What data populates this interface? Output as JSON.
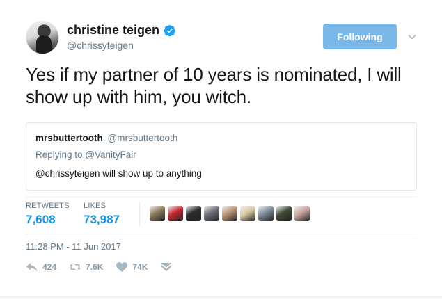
{
  "author": {
    "display_name": "christine teigen",
    "handle": "@chrissyteigen"
  },
  "follow_button": {
    "label": "Following"
  },
  "tweet": {
    "text": "Yes if my partner of 10 years is nominated, I will show up with him, you witch."
  },
  "quoted_tweet": {
    "author_name": "mrsbuttertooth",
    "author_handle": "@mrsbuttertooth",
    "reply_prefix": "Replying to",
    "reply_to": "@VanityFair",
    "text": "@chrissyteigen will show up to anything"
  },
  "stats": {
    "retweets_label": "RETWEETS",
    "retweets_value": "7,608",
    "likes_label": "LIKES",
    "likes_value": "73,987"
  },
  "likers": [
    {
      "icon": "liker-avatar",
      "color": "#8a7a5a"
    },
    {
      "icon": "liker-avatar",
      "color": "#c4282f"
    },
    {
      "icon": "liker-avatar",
      "color": "#2b2b2b"
    },
    {
      "icon": "liker-avatar",
      "color": "#6a6f78"
    },
    {
      "icon": "liker-avatar",
      "color": "#b89477"
    },
    {
      "icon": "liker-avatar",
      "color": "#d9c7a3"
    },
    {
      "icon": "liker-avatar",
      "color": "#7f8c99"
    },
    {
      "icon": "liker-avatar",
      "color": "#3f4a33"
    },
    {
      "icon": "liker-avatar",
      "color": "#c9a2a0"
    }
  ],
  "timestamp": "11:28 PM - 11 Jun 2017",
  "actions": {
    "reply_count": "424",
    "retweet_count": "7.6K",
    "like_count": "74K"
  },
  "colors": {
    "accent": "#1b95e0",
    "follow_button": "#7bb8ea",
    "muted_text": "#657786",
    "action_icon": "#aab8c2"
  }
}
